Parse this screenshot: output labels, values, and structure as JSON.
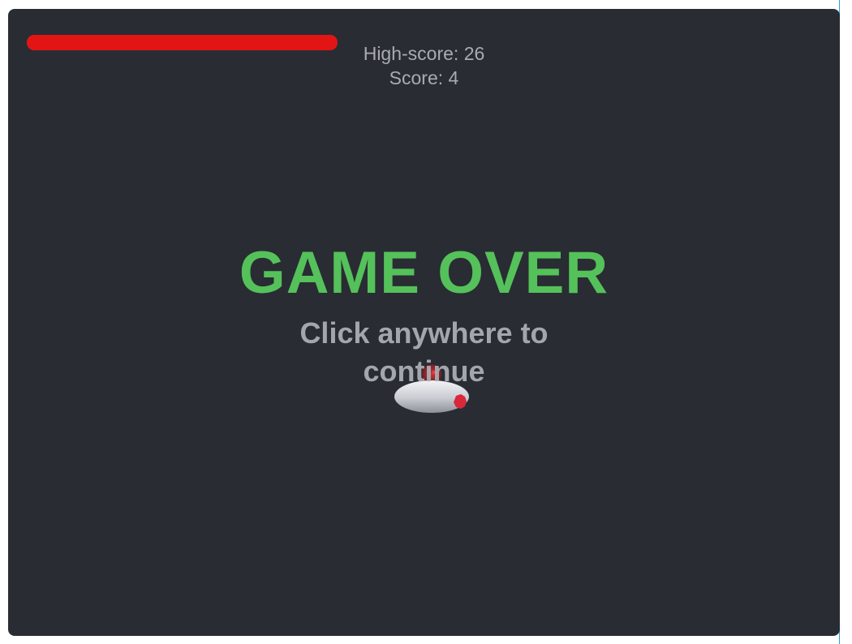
{
  "hud": {
    "health": 1.0,
    "health_color": "#e31414",
    "high_score_label": "High-score: 26",
    "score_label": "Score: 4"
  },
  "overlay": {
    "title": "GAME OVER",
    "title_color": "#55c15a",
    "prompt": "Click anywhere to continue"
  },
  "sprites": {
    "player": "spaceship-icon"
  }
}
